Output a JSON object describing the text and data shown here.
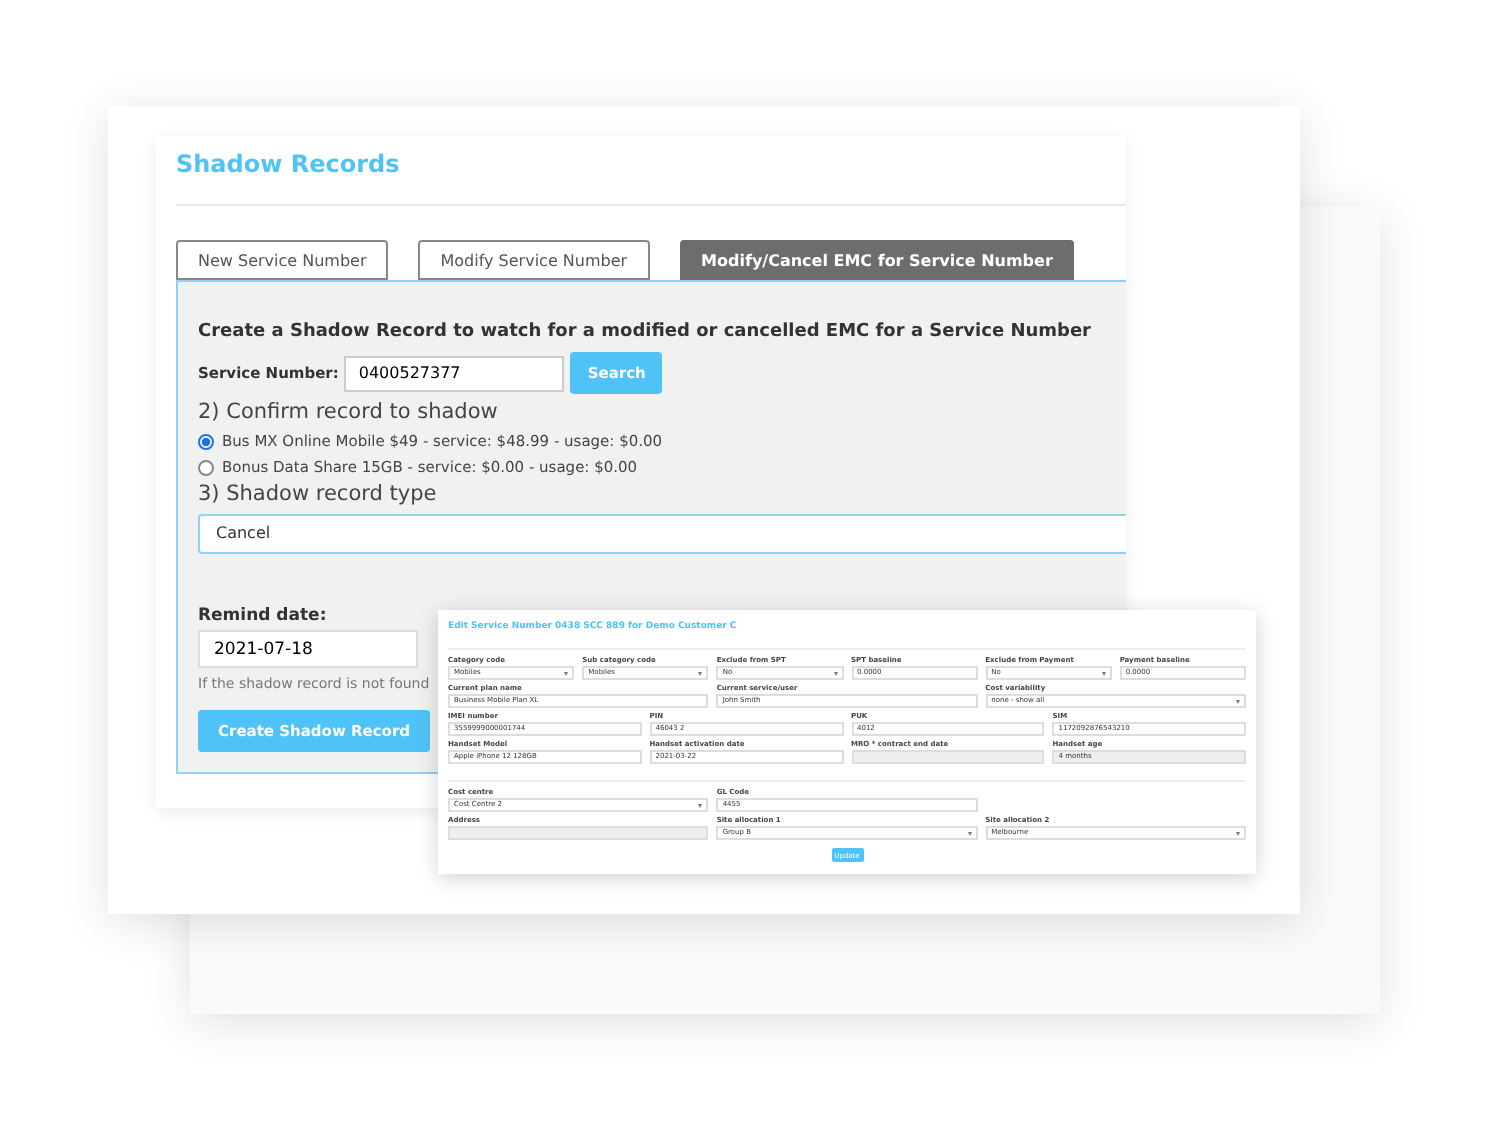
{
  "window": {
    "title": "Shadow Records"
  },
  "tabs": [
    {
      "label": "New Service Number",
      "selected": false
    },
    {
      "label": "Modify Service Number",
      "selected": false
    },
    {
      "label": "Modify/Cancel EMC for Service Number",
      "selected": true
    }
  ],
  "form": {
    "heading": "Create a Shadow Record to watch for a modified or cancelled EMC for a Service Number",
    "service_number_label": "Service Number:",
    "service_number": "0400527377",
    "search_button": "Search",
    "confirm_heading": "2) Confirm record to shadow",
    "records": [
      {
        "label": "Bus MX Online Mobile $49 - service: $48.99 - usage: $0.00",
        "selected": true
      },
      {
        "label": "Bonus Data Share 15GB - service: $0.00 - usage: $0.00",
        "selected": false
      }
    ],
    "type_heading": "3) Shadow record type",
    "record_type": "Cancel",
    "remind_label": "Remind date:",
    "remind_date": "2021-07-18",
    "hint": "If the shadow record is not found",
    "create_button": "Create Shadow Record"
  },
  "edit_dialog": {
    "title": "Edit Service Number 0438 SCC 889 for Demo Customer C",
    "sections": [
      [
        [
          {
            "label": "Category code",
            "value": "Mobiles",
            "kind": "select"
          },
          {
            "label": "Sub category code",
            "value": "Mobiles",
            "kind": "select"
          },
          {
            "label": "Exclude from SPT",
            "value": "No",
            "kind": "select"
          },
          {
            "label": "SPT baseline",
            "value": "0.0000",
            "kind": "input"
          },
          {
            "label": "Exclude from Payment",
            "value": "No",
            "kind": "select"
          },
          {
            "label": "Payment baseline",
            "value": "0.0000",
            "kind": "input"
          }
        ],
        [
          {
            "label": "Current plan name",
            "value": "Business Mobile Plan XL",
            "kind": "input"
          },
          {
            "label": "Current service/user",
            "value": "John Smith",
            "kind": "input"
          },
          {
            "label": "Cost variability",
            "value": "none - show all",
            "kind": "select"
          }
        ],
        [
          {
            "label": "IMEI number",
            "value": "3559999000001744",
            "kind": "input"
          },
          {
            "label": "PIN",
            "value": "46043 2",
            "kind": "input"
          },
          {
            "label": "PUK",
            "value": "4012",
            "kind": "input"
          },
          {
            "label": "SIM",
            "value": "1172092876543210",
            "kind": "input"
          }
        ],
        [
          {
            "label": "Handset Model",
            "value": "Apple iPhone 12 128GB",
            "kind": "input"
          },
          {
            "label": "Handset activation date",
            "value": "2021-03-22",
            "kind": "input"
          },
          {
            "label": "MRO * contract end date",
            "kind": "disabled"
          },
          {
            "label": "Handset age",
            "value": "4 months",
            "kind": "disabled"
          }
        ]
      ],
      [
        [
          {
            "label": "Cost centre",
            "value": "Cost Centre 2",
            "kind": "select"
          },
          {
            "label": "GL Code",
            "value": "4455",
            "kind": "input"
          }
        ],
        [
          {
            "label": "Address",
            "kind": "disabled"
          },
          {
            "label": "Site allocation 1",
            "value": "Group B",
            "kind": "select"
          },
          {
            "label": "Site allocation 2",
            "value": "Melbourne",
            "kind": "select"
          }
        ]
      ]
    ],
    "update_button": "Update"
  }
}
